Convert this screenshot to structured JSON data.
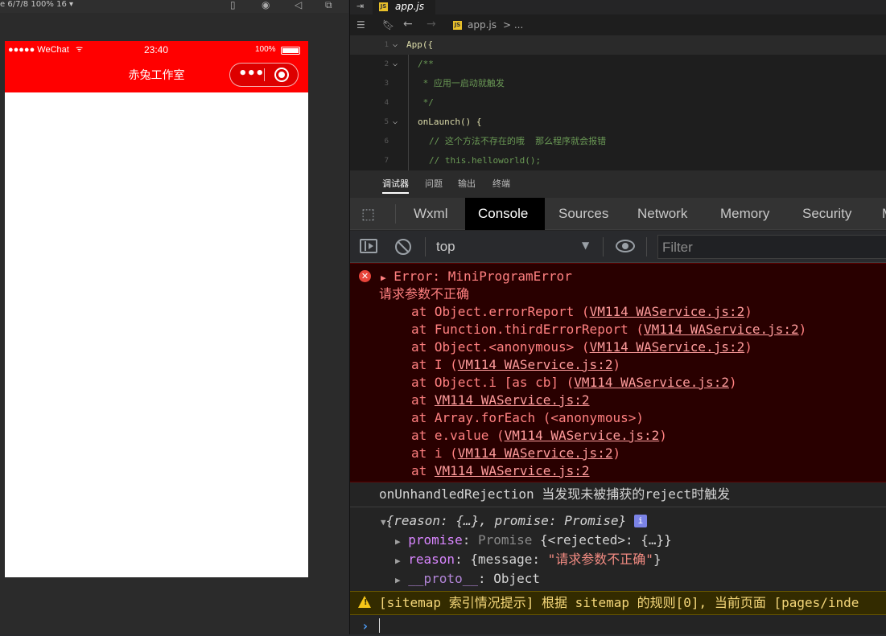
{
  "simulator": {
    "device_info": "e 6/7/8 100% 16 ▾",
    "status_bar": {
      "carrier": "●●●●● WeChat",
      "time": "23:40",
      "battery": "100%"
    },
    "nav_title": "赤兔工作室",
    "capsule_more": "•••"
  },
  "editor": {
    "active_tab": "app.js",
    "breadcrumb": {
      "file": "app.js",
      "more": "> ..."
    },
    "lines": [
      {
        "num": "1",
        "text": "App({"
      },
      {
        "num": "2",
        "text": "/**"
      },
      {
        "num": "3",
        "text": " * 应用一启动就触发"
      },
      {
        "num": "4",
        "text": " */"
      },
      {
        "num": "5",
        "text": "onLaunch() {"
      },
      {
        "num": "6",
        "text": "// 这个方法不存在的哦  那么程序就会报错"
      },
      {
        "num": "7",
        "text": "// this.helloworld();"
      }
    ]
  },
  "devtools": {
    "top_tabs": [
      "调试器",
      "问题",
      "输出",
      "终端"
    ],
    "panels": [
      "Wxml",
      "Console",
      "Sources",
      "Network",
      "Memory",
      "Security",
      "M"
    ],
    "active_panel": "Console",
    "context": "top",
    "filter_placeholder": "Filter"
  },
  "console": {
    "error": {
      "head": "Error: MiniProgramError",
      "message": "请求参数不正确",
      "stack": [
        {
          "pre": "at Object.errorReport (",
          "link": "VM114 WAService.js:2",
          "post": ")"
        },
        {
          "pre": "at Function.thirdErrorReport (",
          "link": "VM114 WAService.js:2",
          "post": ")"
        },
        {
          "pre": "at Object.<anonymous> (",
          "link": "VM114 WAService.js:2",
          "post": ")"
        },
        {
          "pre": "at I (",
          "link": "VM114 WAService.js:2",
          "post": ")"
        },
        {
          "pre": "at Object.i [as cb] (",
          "link": "VM114 WAService.js:2",
          "post": ")"
        },
        {
          "pre": "at ",
          "link": "VM114 WAService.js:2",
          "post": ""
        },
        {
          "pre": "at Array.forEach (<anonymous>)",
          "link": "",
          "post": ""
        },
        {
          "pre": "at e.value (",
          "link": "VM114 WAService.js:2",
          "post": ")"
        },
        {
          "pre": "at i (",
          "link": "VM114 WAService.js:2",
          "post": ")"
        },
        {
          "pre": "at ",
          "link": "VM114 WAService.js:2",
          "post": ""
        }
      ]
    },
    "rejection_log": "onUnhandledRejection 当发现未被捕获的reject时触发",
    "object_summary": {
      "k1": "reason",
      "v1": "{…}",
      "k2": "promise",
      "v2": "Promise"
    },
    "props": [
      {
        "key": "promise",
        "value_dim": "Promise",
        "value": "{<rejected>: {…}}"
      },
      {
        "key": "reason",
        "value_dim": "",
        "value": "{message: ",
        "str": "\"请求参数不正确\"",
        "tail": "}"
      },
      {
        "key": "__proto__",
        "value_dim": "",
        "value": "Object"
      }
    ],
    "warning": "[sitemap 索引情况提示] 根据 sitemap 的规则[0], 当前页面 [pages/inde"
  },
  "colors": {
    "nav_red": "#ff0000",
    "error_bg": "#290000",
    "error_text": "#ff8080",
    "warn_bg": "#332b00",
    "warn_text": "#f5d77a"
  }
}
